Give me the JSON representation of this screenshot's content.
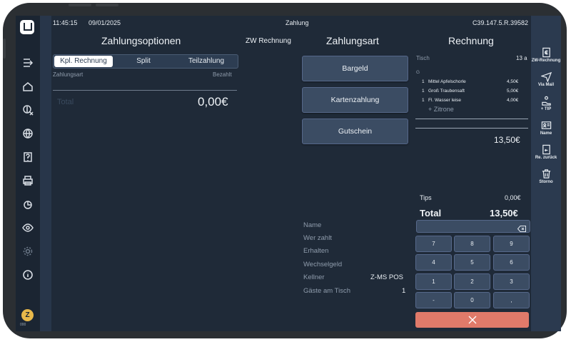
{
  "status": {
    "time": "11:45:15",
    "date": "09/01/2025",
    "screen": "Zahlung",
    "device_id": "C39.147.5.R.39582"
  },
  "headers": {
    "options": "Zahlungsoptionen",
    "zw": "ZW Rechnung",
    "payment_type": "Zahlungsart",
    "invoice": "Rechnung"
  },
  "tabs": [
    "Kpl. Rechnung",
    "Split",
    "Teilzahlung"
  ],
  "options": {
    "col_type": "Zahlungsart",
    "col_paid": "Bezahlt",
    "total_label": "Total",
    "total_value": "0,00€"
  },
  "payment_buttons": [
    "Bargeld",
    "Kartenzahlung",
    "Gutschein"
  ],
  "invoice": {
    "table_label": "Tisch",
    "table_value": "13 a",
    "group": "G",
    "items": [
      {
        "qty": "1",
        "name": "Mittel Apfelschorle",
        "price": "4,50€"
      },
      {
        "qty": "1",
        "name": "Groß Traubensaft",
        "price": "5,00€"
      },
      {
        "qty": "1",
        "name": "Fl. Wasser leise",
        "price": "4,00€"
      }
    ],
    "modifier": "+ Zitrone",
    "subtotal": "13,50€",
    "tips_label": "Tips",
    "tips_value": "0,00€",
    "total_label": "Total",
    "total_value": "13,50€"
  },
  "form": {
    "name": "Name",
    "payer": "Wer zahlt",
    "received": "Erhalten",
    "change": "Wechselgeld",
    "waiter_label": "Kellner",
    "waiter_value": "Z-MS POS",
    "guests_label": "Gäste am Tisch",
    "guests_value": "1"
  },
  "keypad": [
    "7",
    "8",
    "9",
    "4",
    "5",
    "6",
    "1",
    "2",
    "3",
    "-",
    "0",
    ","
  ],
  "right_actions": [
    "ZW-Rechnung",
    "Via Mail",
    "+ TIP",
    "Name",
    "Re. zurück",
    "Storno"
  ],
  "avatar": {
    "letter": "Z",
    "sub": "000"
  },
  "colors": {
    "background": "#1f2a38",
    "button": "#3b4c63",
    "cancel": "#e07a6a",
    "right_bar": "#2b3a4f"
  }
}
